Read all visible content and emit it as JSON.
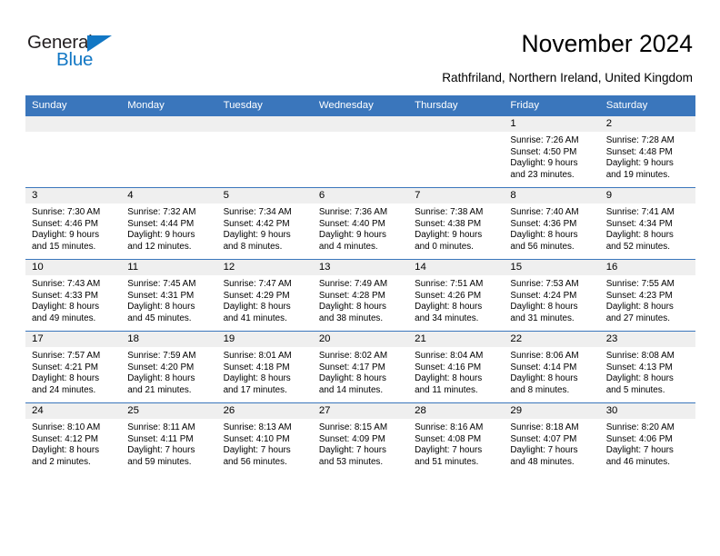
{
  "brand": {
    "name_part1": "General",
    "name_part2": "Blue",
    "colors": {
      "blue": "#1277c4",
      "dark": "#231f20"
    }
  },
  "header": {
    "title": "November 2024",
    "location": "Rathfriland, Northern Ireland, United Kingdom"
  },
  "theme": {
    "header_blue": "#3a76bc",
    "daynum_band": "#efefef",
    "text": "#000000"
  },
  "calendar": {
    "weekday_headers": [
      "Sunday",
      "Monday",
      "Tuesday",
      "Wednesday",
      "Thursday",
      "Friday",
      "Saturday"
    ],
    "weeks": [
      [
        {
          "day": "",
          "empty": true
        },
        {
          "day": "",
          "empty": true
        },
        {
          "day": "",
          "empty": true
        },
        {
          "day": "",
          "empty": true
        },
        {
          "day": "",
          "empty": true
        },
        {
          "day": "1",
          "sunrise": "Sunrise: 7:26 AM",
          "sunset": "Sunset: 4:50 PM",
          "daylight1": "Daylight: 9 hours",
          "daylight2": "and 23 minutes."
        },
        {
          "day": "2",
          "sunrise": "Sunrise: 7:28 AM",
          "sunset": "Sunset: 4:48 PM",
          "daylight1": "Daylight: 9 hours",
          "daylight2": "and 19 minutes."
        }
      ],
      [
        {
          "day": "3",
          "sunrise": "Sunrise: 7:30 AM",
          "sunset": "Sunset: 4:46 PM",
          "daylight1": "Daylight: 9 hours",
          "daylight2": "and 15 minutes."
        },
        {
          "day": "4",
          "sunrise": "Sunrise: 7:32 AM",
          "sunset": "Sunset: 4:44 PM",
          "daylight1": "Daylight: 9 hours",
          "daylight2": "and 12 minutes."
        },
        {
          "day": "5",
          "sunrise": "Sunrise: 7:34 AM",
          "sunset": "Sunset: 4:42 PM",
          "daylight1": "Daylight: 9 hours",
          "daylight2": "and 8 minutes."
        },
        {
          "day": "6",
          "sunrise": "Sunrise: 7:36 AM",
          "sunset": "Sunset: 4:40 PM",
          "daylight1": "Daylight: 9 hours",
          "daylight2": "and 4 minutes."
        },
        {
          "day": "7",
          "sunrise": "Sunrise: 7:38 AM",
          "sunset": "Sunset: 4:38 PM",
          "daylight1": "Daylight: 9 hours",
          "daylight2": "and 0 minutes."
        },
        {
          "day": "8",
          "sunrise": "Sunrise: 7:40 AM",
          "sunset": "Sunset: 4:36 PM",
          "daylight1": "Daylight: 8 hours",
          "daylight2": "and 56 minutes."
        },
        {
          "day": "9",
          "sunrise": "Sunrise: 7:41 AM",
          "sunset": "Sunset: 4:34 PM",
          "daylight1": "Daylight: 8 hours",
          "daylight2": "and 52 minutes."
        }
      ],
      [
        {
          "day": "10",
          "sunrise": "Sunrise: 7:43 AM",
          "sunset": "Sunset: 4:33 PM",
          "daylight1": "Daylight: 8 hours",
          "daylight2": "and 49 minutes."
        },
        {
          "day": "11",
          "sunrise": "Sunrise: 7:45 AM",
          "sunset": "Sunset: 4:31 PM",
          "daylight1": "Daylight: 8 hours",
          "daylight2": "and 45 minutes."
        },
        {
          "day": "12",
          "sunrise": "Sunrise: 7:47 AM",
          "sunset": "Sunset: 4:29 PM",
          "daylight1": "Daylight: 8 hours",
          "daylight2": "and 41 minutes."
        },
        {
          "day": "13",
          "sunrise": "Sunrise: 7:49 AM",
          "sunset": "Sunset: 4:28 PM",
          "daylight1": "Daylight: 8 hours",
          "daylight2": "and 38 minutes."
        },
        {
          "day": "14",
          "sunrise": "Sunrise: 7:51 AM",
          "sunset": "Sunset: 4:26 PM",
          "daylight1": "Daylight: 8 hours",
          "daylight2": "and 34 minutes."
        },
        {
          "day": "15",
          "sunrise": "Sunrise: 7:53 AM",
          "sunset": "Sunset: 4:24 PM",
          "daylight1": "Daylight: 8 hours",
          "daylight2": "and 31 minutes."
        },
        {
          "day": "16",
          "sunrise": "Sunrise: 7:55 AM",
          "sunset": "Sunset: 4:23 PM",
          "daylight1": "Daylight: 8 hours",
          "daylight2": "and 27 minutes."
        }
      ],
      [
        {
          "day": "17",
          "sunrise": "Sunrise: 7:57 AM",
          "sunset": "Sunset: 4:21 PM",
          "daylight1": "Daylight: 8 hours",
          "daylight2": "and 24 minutes."
        },
        {
          "day": "18",
          "sunrise": "Sunrise: 7:59 AM",
          "sunset": "Sunset: 4:20 PM",
          "daylight1": "Daylight: 8 hours",
          "daylight2": "and 21 minutes."
        },
        {
          "day": "19",
          "sunrise": "Sunrise: 8:01 AM",
          "sunset": "Sunset: 4:18 PM",
          "daylight1": "Daylight: 8 hours",
          "daylight2": "and 17 minutes."
        },
        {
          "day": "20",
          "sunrise": "Sunrise: 8:02 AM",
          "sunset": "Sunset: 4:17 PM",
          "daylight1": "Daylight: 8 hours",
          "daylight2": "and 14 minutes."
        },
        {
          "day": "21",
          "sunrise": "Sunrise: 8:04 AM",
          "sunset": "Sunset: 4:16 PM",
          "daylight1": "Daylight: 8 hours",
          "daylight2": "and 11 minutes."
        },
        {
          "day": "22",
          "sunrise": "Sunrise: 8:06 AM",
          "sunset": "Sunset: 4:14 PM",
          "daylight1": "Daylight: 8 hours",
          "daylight2": "and 8 minutes."
        },
        {
          "day": "23",
          "sunrise": "Sunrise: 8:08 AM",
          "sunset": "Sunset: 4:13 PM",
          "daylight1": "Daylight: 8 hours",
          "daylight2": "and 5 minutes."
        }
      ],
      [
        {
          "day": "24",
          "sunrise": "Sunrise: 8:10 AM",
          "sunset": "Sunset: 4:12 PM",
          "daylight1": "Daylight: 8 hours",
          "daylight2": "and 2 minutes."
        },
        {
          "day": "25",
          "sunrise": "Sunrise: 8:11 AM",
          "sunset": "Sunset: 4:11 PM",
          "daylight1": "Daylight: 7 hours",
          "daylight2": "and 59 minutes."
        },
        {
          "day": "26",
          "sunrise": "Sunrise: 8:13 AM",
          "sunset": "Sunset: 4:10 PM",
          "daylight1": "Daylight: 7 hours",
          "daylight2": "and 56 minutes."
        },
        {
          "day": "27",
          "sunrise": "Sunrise: 8:15 AM",
          "sunset": "Sunset: 4:09 PM",
          "daylight1": "Daylight: 7 hours",
          "daylight2": "and 53 minutes."
        },
        {
          "day": "28",
          "sunrise": "Sunrise: 8:16 AM",
          "sunset": "Sunset: 4:08 PM",
          "daylight1": "Daylight: 7 hours",
          "daylight2": "and 51 minutes."
        },
        {
          "day": "29",
          "sunrise": "Sunrise: 8:18 AM",
          "sunset": "Sunset: 4:07 PM",
          "daylight1": "Daylight: 7 hours",
          "daylight2": "and 48 minutes."
        },
        {
          "day": "30",
          "sunrise": "Sunrise: 8:20 AM",
          "sunset": "Sunset: 4:06 PM",
          "daylight1": "Daylight: 7 hours",
          "daylight2": "and 46 minutes."
        }
      ]
    ]
  }
}
